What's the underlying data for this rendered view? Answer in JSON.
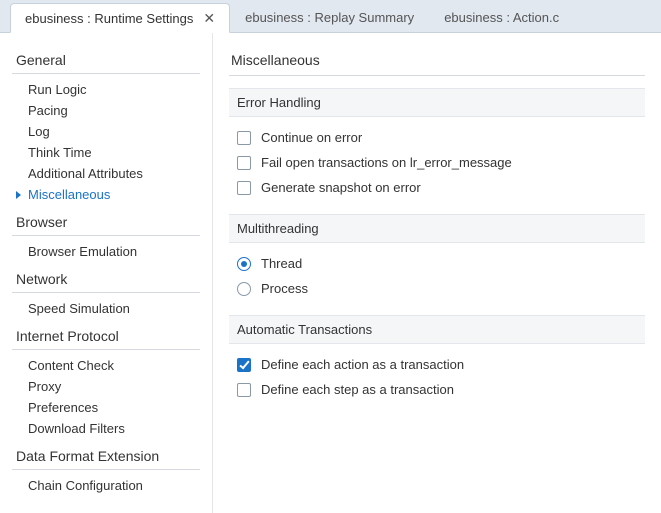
{
  "tabs": [
    {
      "label": "ebusiness : Runtime Settings",
      "active": true,
      "closeable": true
    },
    {
      "label": "ebusiness : Replay Summary",
      "active": false,
      "closeable": false
    },
    {
      "label": "ebusiness : Action.c",
      "active": false,
      "closeable": false
    }
  ],
  "sidebar": [
    {
      "header": "General",
      "items": [
        {
          "label": "Run Logic",
          "selected": false
        },
        {
          "label": "Pacing",
          "selected": false
        },
        {
          "label": "Log",
          "selected": false
        },
        {
          "label": "Think Time",
          "selected": false
        },
        {
          "label": "Additional Attributes",
          "selected": false
        },
        {
          "label": "Miscellaneous",
          "selected": true
        }
      ]
    },
    {
      "header": "Browser",
      "items": [
        {
          "label": "Browser Emulation",
          "selected": false
        }
      ]
    },
    {
      "header": "Network",
      "items": [
        {
          "label": "Speed Simulation",
          "selected": false
        }
      ]
    },
    {
      "header": "Internet Protocol",
      "items": [
        {
          "label": "Content Check",
          "selected": false
        },
        {
          "label": "Proxy",
          "selected": false
        },
        {
          "label": "Preferences",
          "selected": false
        },
        {
          "label": "Download Filters",
          "selected": false
        }
      ]
    },
    {
      "header": "Data Format Extension",
      "items": [
        {
          "label": "Chain Configuration",
          "selected": false
        }
      ]
    }
  ],
  "page": {
    "title": "Miscellaneous",
    "sections": [
      {
        "header": "Error Handling",
        "type": "checkbox",
        "options": [
          {
            "label": "Continue on error",
            "checked": false
          },
          {
            "label": "Fail open transactions on lr_error_message",
            "checked": false
          },
          {
            "label": "Generate snapshot on error",
            "checked": false
          }
        ]
      },
      {
        "header": "Multithreading",
        "type": "radio",
        "options": [
          {
            "label": "Thread",
            "checked": true
          },
          {
            "label": "Process",
            "checked": false
          }
        ]
      },
      {
        "header": "Automatic Transactions",
        "type": "checkbox",
        "options": [
          {
            "label": "Define each action as a transaction",
            "checked": true
          },
          {
            "label": "Define each step as a transaction",
            "checked": false
          }
        ]
      }
    ]
  }
}
